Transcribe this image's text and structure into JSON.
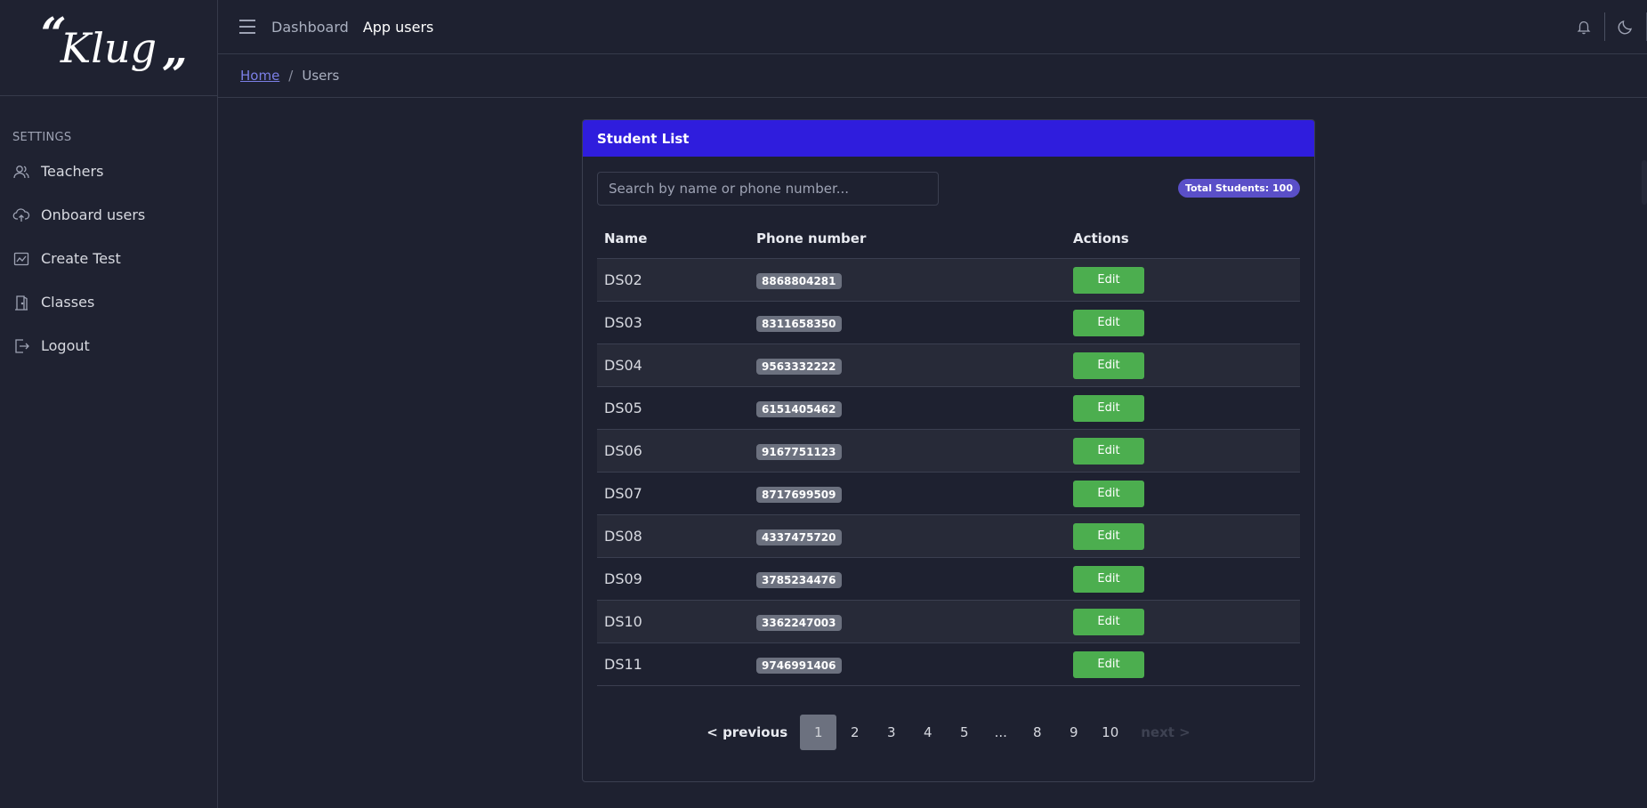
{
  "sidebar": {
    "logo_text": "Klug",
    "logo_quote_open": "“",
    "logo_quote_close": "”",
    "section_title": "SETTINGS",
    "items": [
      {
        "label": "Teachers",
        "icon": "users-icon"
      },
      {
        "label": "Onboard users",
        "icon": "cloud-upload-icon"
      },
      {
        "label": "Create Test",
        "icon": "chart-icon"
      },
      {
        "label": "Classes",
        "icon": "door-icon"
      },
      {
        "label": "Logout",
        "icon": "logout-icon"
      }
    ]
  },
  "header": {
    "nav": [
      "Dashboard",
      "App users"
    ]
  },
  "breadcrumb": {
    "home": "Home",
    "separator": "/",
    "current": "Users"
  },
  "card": {
    "title": "Student List",
    "search_placeholder": "Search by name or phone number...",
    "total_label": "Total Students: 100",
    "columns": [
      "Name",
      "Phone number",
      "Actions"
    ],
    "edit_label": "Edit",
    "rows": [
      {
        "name": "DS02",
        "phone": "8868804281"
      },
      {
        "name": "DS03",
        "phone": "8311658350"
      },
      {
        "name": "DS04",
        "phone": "9563332222"
      },
      {
        "name": "DS05",
        "phone": "6151405462"
      },
      {
        "name": "DS06",
        "phone": "9167751123"
      },
      {
        "name": "DS07",
        "phone": "8717699509"
      },
      {
        "name": "DS08",
        "phone": "4337475720"
      },
      {
        "name": "DS09",
        "phone": "3785234476"
      },
      {
        "name": "DS10",
        "phone": "3362247003"
      },
      {
        "name": "DS11",
        "phone": "9746991406"
      }
    ]
  },
  "pagination": {
    "previous": "< previous",
    "pages": [
      "1",
      "2",
      "3",
      "4",
      "5",
      "...",
      "8",
      "9",
      "10"
    ],
    "current_page": "1",
    "next": "next >"
  },
  "colors": {
    "background": "#1e2130",
    "card_header": "#2f1ddd",
    "edit_button": "#4cae4f",
    "badge": "#5a4fc8",
    "link": "#7b7fe6"
  }
}
